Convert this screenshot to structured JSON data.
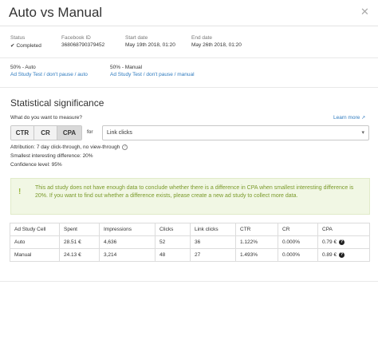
{
  "header": {
    "title": "Auto vs Manual",
    "close_glyph": "✕"
  },
  "meta": {
    "status_label": "Status",
    "status_value": "Completed",
    "status_icon": "check-icon",
    "fb_id_label": "Facebook ID",
    "fb_id_value": "368068790379452",
    "start_label": "Start date",
    "start_value": "May 19th 2018, 01:20",
    "end_label": "End date",
    "end_value": "May 26th 2018, 01:20"
  },
  "variants": [
    {
      "pct": "50% - Auto",
      "link": "Ad Study Test / don't pause / auto"
    },
    {
      "pct": "50% - Manual",
      "link": "Ad Study Test / don't pause / manual"
    }
  ],
  "significance": {
    "title": "Statistical significance",
    "question": "What do you want to measure?",
    "learn_more": "Learn more",
    "metrics": [
      "CTR",
      "CR",
      "CPA"
    ],
    "selected_metric": "CPA",
    "for_label": "for",
    "event_value": "Link clicks",
    "attribution": "Attribution: 7 day click-through, no view-through",
    "smallest_diff": "Smallest interesting difference: 20%",
    "confidence": "Confidence level: 95%",
    "warning_icon": "!",
    "warning": "This ad study does not have enough data to conclude whether there is a difference in CPA when smallest interesting difference is 20%. If you want to find out whether a difference exists, please create a new ad study to collect more data."
  },
  "table": {
    "headers": [
      "Ad Study Cell",
      "Spent",
      "Impressions",
      "Clicks",
      "Link clicks",
      "CTR",
      "CR",
      "CPA"
    ],
    "rows": [
      [
        "Auto",
        "28.51 €",
        "4,636",
        "52",
        "36",
        "1.122%",
        "0.000%",
        "0.79 €"
      ],
      [
        "Manual",
        "24.13 €",
        "3,214",
        "48",
        "27",
        "1.493%",
        "0.000%",
        "0.89 €"
      ]
    ]
  },
  "colors": {
    "link": "#2f7bbf",
    "warning_bg": "#f1f7e4",
    "warning_text": "#7a9a2a",
    "selected_segment": "#d9d9d9"
  }
}
